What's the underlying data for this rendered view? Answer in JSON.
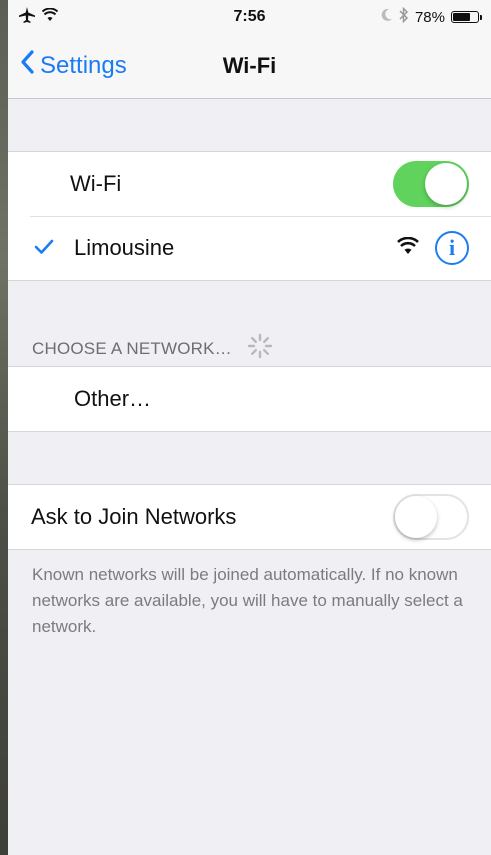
{
  "status_bar": {
    "time": "7:56",
    "battery_percent": "78%",
    "battery_level": 0.78
  },
  "nav": {
    "back_label": "Settings",
    "title": "Wi-Fi"
  },
  "wifi_group": {
    "toggle_label": "Wi-Fi",
    "toggle_on": true,
    "connected_network": "Limousine"
  },
  "networks": {
    "header": "CHOOSE A NETWORK…",
    "other_label": "Other…"
  },
  "ask_join": {
    "label": "Ask to Join Networks",
    "toggle_on": false,
    "note": "Known networks will be joined automatically. If no known networks are available, you will have to manually select a network."
  },
  "colors": {
    "accent": "#1a7cf5",
    "toggle_on": "#5fd35b",
    "background": "#efeff4"
  }
}
